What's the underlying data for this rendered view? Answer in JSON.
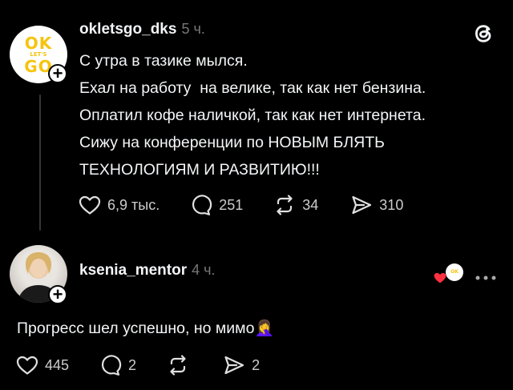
{
  "post": {
    "username": "okletsgo_dks",
    "time": "5 ч.",
    "avatar_logo": {
      "top": "OK",
      "middle": "LET'S",
      "bottom": "GO"
    },
    "lines": [
      "С утра в тазике мылся.",
      "Ехал на работу  на велике, так как нет бензина.",
      "Оплатил кофе наличкой, так как нет интернета.",
      "Сижу на конференции по НОВЫМ БЛЯТЬ",
      "ТЕХНОЛОГИЯМ И РАЗВИТИЮ!!!"
    ],
    "likes": "6,9 тыс.",
    "comments": "251",
    "reposts": "34",
    "shares": "310"
  },
  "reply": {
    "username": "ksenia_mentor",
    "time": "4 ч.",
    "text": "Прогресс шел успешно, но мимо",
    "emoji": "🤦‍♀️",
    "likes": "445",
    "comments": "2",
    "shares": "2"
  },
  "colors": {
    "background": "#000000",
    "text": "#f3f5f7",
    "muted": "#777777",
    "logo_yellow": "#f6c40f",
    "heart_red": "#ff3040"
  }
}
